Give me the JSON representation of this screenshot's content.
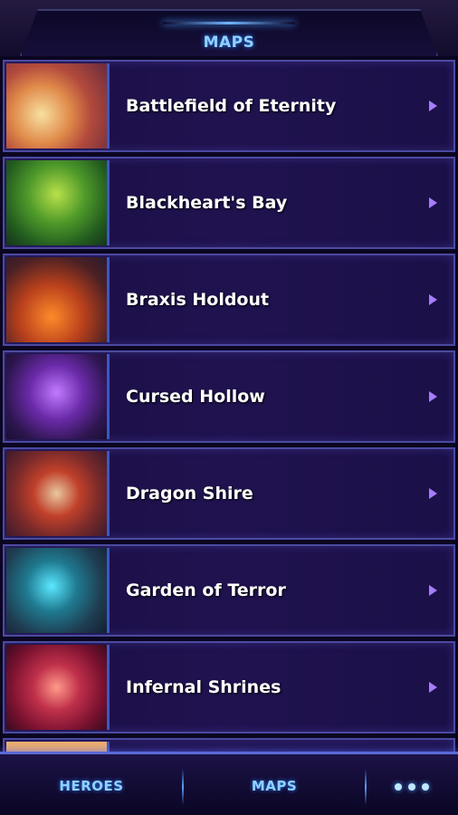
{
  "header": {
    "title": "MAPS"
  },
  "maps": [
    {
      "label": "Battlefield of Eternity",
      "icon": "chevron-right-icon"
    },
    {
      "label": "Blackheart's Bay",
      "icon": "chevron-right-icon"
    },
    {
      "label": "Braxis Holdout",
      "icon": "chevron-right-icon"
    },
    {
      "label": "Cursed Hollow",
      "icon": "chevron-right-icon"
    },
    {
      "label": "Dragon Shire",
      "icon": "chevron-right-icon"
    },
    {
      "label": "Garden of Terror",
      "icon": "chevron-right-icon"
    },
    {
      "label": "Infernal Shrines",
      "icon": "chevron-right-icon"
    }
  ],
  "bottom_nav": {
    "heroes_label": "HEROES",
    "maps_label": "MAPS",
    "more_icon": "more-dots-icon"
  },
  "colors": {
    "accent": "#8fd1ff",
    "row_border": "#4b4aa0",
    "chevron": "#a77cff"
  }
}
